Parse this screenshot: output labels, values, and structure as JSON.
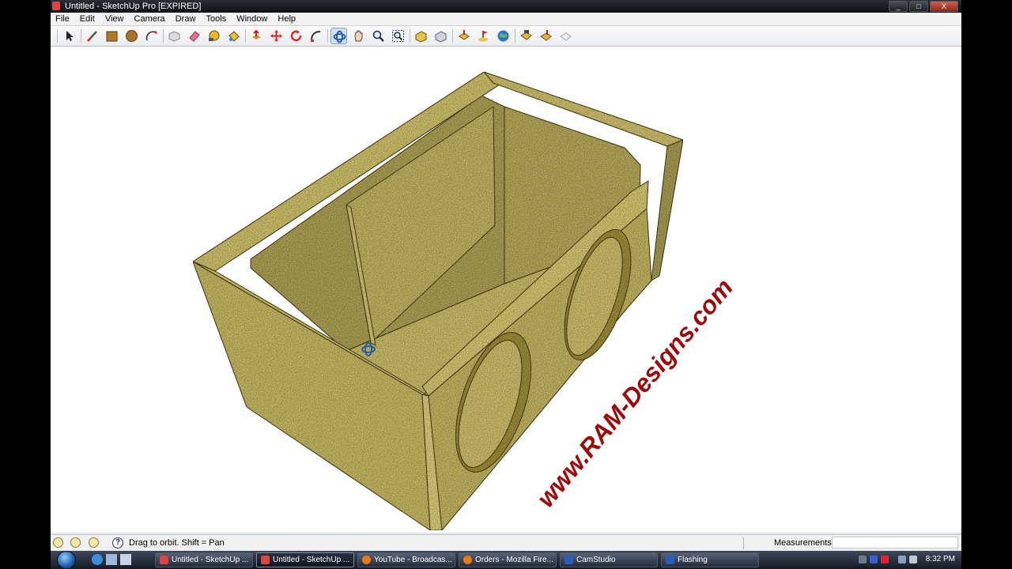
{
  "window": {
    "title": "Untitled - SketchUp Pro [EXPIRED]",
    "controls": [
      "_",
      "□",
      "X"
    ]
  },
  "menu": [
    "File",
    "Edit",
    "View",
    "Camera",
    "Draw",
    "Tools",
    "Window",
    "Help"
  ],
  "toolbar": {
    "tools": [
      "select",
      "line",
      "rectangle",
      "circle",
      "arc",
      "make-component",
      "eraser",
      "tape-measure",
      "paint-bucket",
      "push-pull",
      "move",
      "rotate",
      "follow-me",
      "orbit",
      "pan",
      "zoom",
      "zoom-extents",
      "3d-warehouse",
      "share-model",
      "get-models",
      "add-location",
      "toggle-terrain",
      "photo-textures",
      "get-photo-texture",
      "preview-google-earth"
    ],
    "active_tool": "orbit"
  },
  "viewport": {
    "watermark": "www.RAM-Designs.com",
    "watermark_color": "#9c0a0a",
    "wood_color": "#d8c96a",
    "background_color": "#ffffff"
  },
  "status": {
    "hint": "Drag to orbit.  Shift = Pan",
    "measurements_label": "Measurements",
    "measurements_value": ""
  },
  "taskbar": {
    "buttons": [
      "Untitled - SketchUp ...",
      "Untitled - SketchUp ...",
      "YouTube - Broadcas...",
      "Orders - Mozilla Fire...",
      "CamStudio",
      "Flashing"
    ],
    "active_index": 1,
    "clock": "8:32 PM"
  }
}
